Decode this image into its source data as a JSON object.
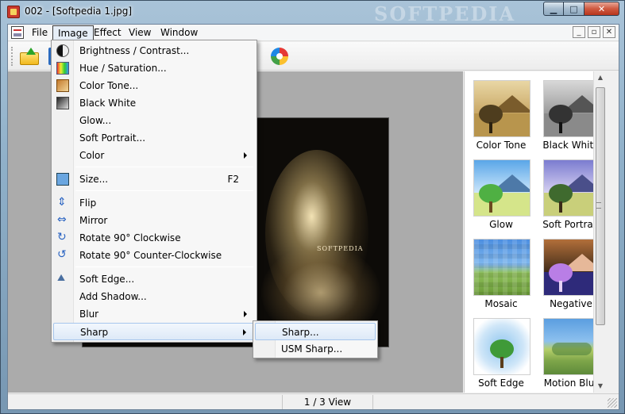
{
  "window": {
    "title": "002 - [Softpedia 1.jpg]",
    "watermark": "SOFTPEDIA",
    "controls": {
      "minimize": "▁",
      "maximize": "□",
      "close": "✕"
    }
  },
  "menubar": {
    "items": [
      {
        "label": "File"
      },
      {
        "label": "Image"
      },
      {
        "label": "Effect"
      },
      {
        "label": "View"
      },
      {
        "label": "Window"
      }
    ],
    "mdi_controls": {
      "minimize": "_",
      "restore": "▫",
      "close": "✕"
    }
  },
  "image_menu": {
    "items": [
      {
        "label": "Brightness / Contrast...",
        "icon": "contrast-icon"
      },
      {
        "label": "Hue / Saturation...",
        "icon": "hue-icon"
      },
      {
        "label": "Color Tone...",
        "icon": "color-tone-icon"
      },
      {
        "label": "Black White",
        "icon": "black-white-icon"
      },
      {
        "label": "Glow..."
      },
      {
        "label": "Soft Portrait..."
      },
      {
        "label": "Color",
        "submenu": true
      },
      {
        "label": "Size...",
        "shortcut": "F2",
        "icon": "resize-icon"
      },
      {
        "label": "Flip",
        "icon": "flip-icon"
      },
      {
        "label": "Mirror",
        "icon": "mirror-icon"
      },
      {
        "label": "Rotate 90° Clockwise",
        "icon": "rotate-cw-icon"
      },
      {
        "label": "Rotate 90° Counter-Clockwise",
        "icon": "rotate-ccw-icon"
      },
      {
        "label": "Soft Edge...",
        "icon": "soft-edge-icon"
      },
      {
        "label": "Add Shadow..."
      },
      {
        "label": "Blur",
        "submenu": true
      },
      {
        "label": "Sharp",
        "submenu": true,
        "highlighted": true
      }
    ]
  },
  "sharp_submenu": {
    "items": [
      {
        "label": "Sharp...",
        "highlighted": true
      },
      {
        "label": "USM Sharp..."
      }
    ]
  },
  "photo": {
    "caption": "SOFTPEDIA"
  },
  "thumbnails": [
    {
      "label": "Color Tone"
    },
    {
      "label": "Black White"
    },
    {
      "label": "Glow"
    },
    {
      "label": "Soft Portrait"
    },
    {
      "label": "Mosaic"
    },
    {
      "label": "Negative"
    },
    {
      "label": "Soft Edge"
    },
    {
      "label": "Motion Blur"
    }
  ],
  "statusbar": {
    "view": "1 / 3 View"
  },
  "colors": {
    "highlight": "#dde9f7",
    "highlight_border": "#a7c6ec",
    "canvas": "#ababab"
  }
}
